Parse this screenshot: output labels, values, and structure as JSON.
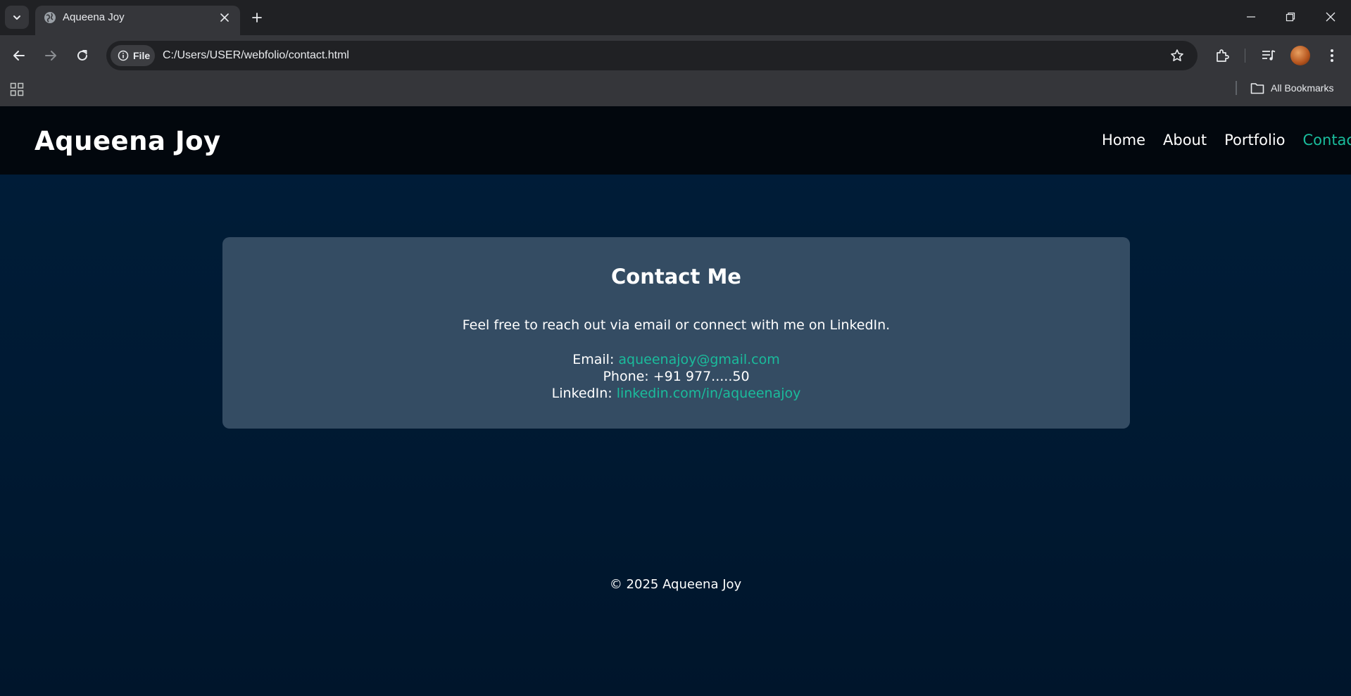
{
  "browser": {
    "tab_title": "Aqueena Joy",
    "site_chip_label": "File",
    "url": "C:/Users/USER/webfolio/contact.html",
    "bookmarks_label": "All Bookmarks"
  },
  "site": {
    "brand": "Aqueena Joy",
    "nav": [
      {
        "label": "Home",
        "active": false
      },
      {
        "label": "About",
        "active": false
      },
      {
        "label": "Portfolio",
        "active": false
      },
      {
        "label": "Contact",
        "active": true
      }
    ]
  },
  "contact": {
    "heading": "Contact Me",
    "intro": "Feel free to reach out via email or connect with me on LinkedIn.",
    "email_label": "Email:",
    "email_value": "aqueenajoy@gmail.com",
    "phone_label": "Phone:",
    "phone_value": "+91 977.....50",
    "linkedin_label": "LinkedIn:",
    "linkedin_value": "linkedin.com/in/aqueenajoy"
  },
  "footer": {
    "text": "© 2025 Aqueena Joy"
  },
  "colors": {
    "accent": "#1abc9c",
    "header_bg": "#02070d",
    "card_bg": "#344c63",
    "page_bg": "#001a33"
  }
}
